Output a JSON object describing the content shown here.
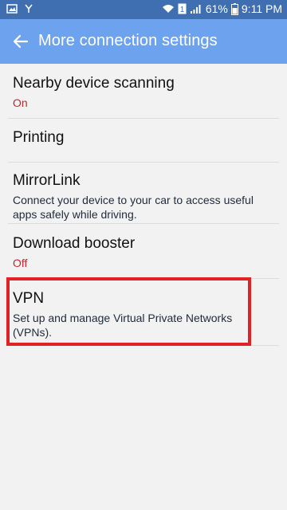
{
  "status_bar": {
    "battery_percent": "61%",
    "time": "9:11 PM",
    "sim_badge": "1",
    "icons": [
      "image-notification-icon",
      "missed-call-icon",
      "wifi-icon",
      "sim-icon",
      "signal-icon",
      "battery-icon"
    ]
  },
  "appbar": {
    "title": "More connection settings",
    "back_icon": "arrow-left-icon"
  },
  "items": [
    {
      "title": "Nearby device scanning",
      "subtitle": "On"
    },
    {
      "title": "Printing"
    },
    {
      "title": "MirrorLink",
      "subtitle": "Connect your device to your car to access useful apps safely while driving."
    },
    {
      "title": "Download booster",
      "subtitle": "Off"
    },
    {
      "title": "VPN",
      "subtitle": "Set up and manage Virtual Private Networks (VPNs)."
    }
  ],
  "colors": {
    "status_bar": "#3f6fb0",
    "app_bar": "#6da3ee",
    "accent_red": "#c0262c",
    "highlight": "#e02227",
    "background": "#f2f2f2"
  }
}
